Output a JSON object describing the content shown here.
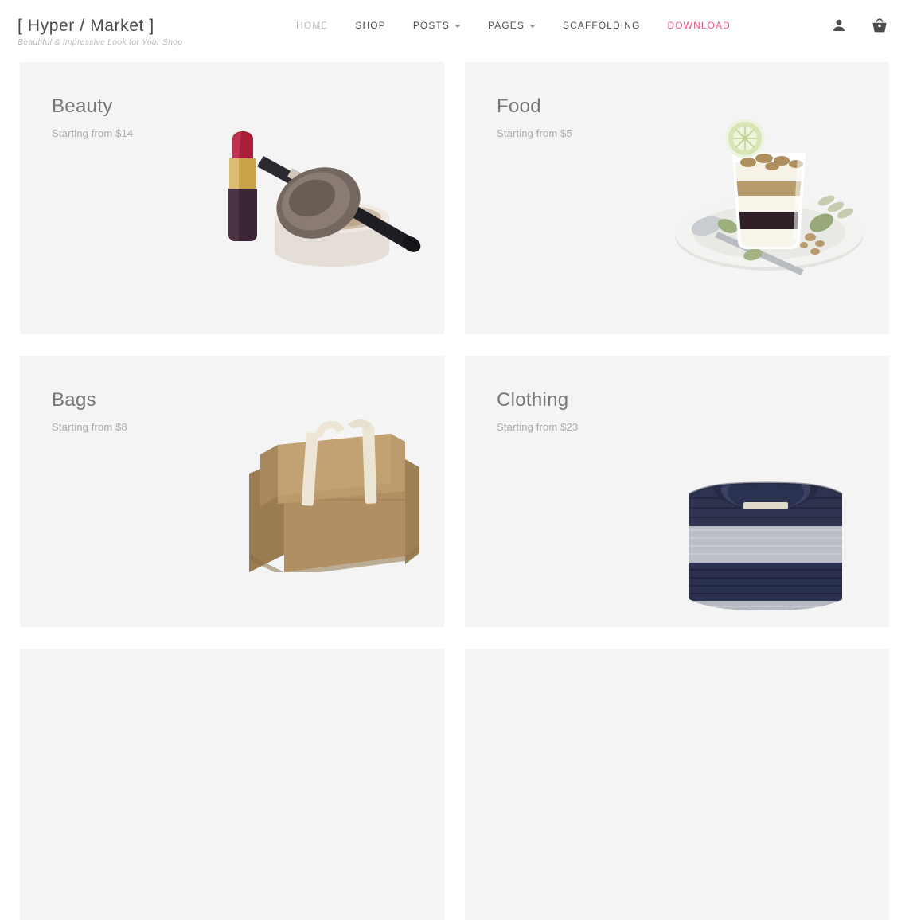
{
  "header": {
    "brand_title": "[ Hyper / Market ]",
    "brand_tagline": "Beautiful & Impressive Look for Your Shop",
    "nav": [
      {
        "label": "HOME",
        "state": "muted",
        "caret": false
      },
      {
        "label": "SHOP",
        "state": "normal",
        "caret": false
      },
      {
        "label": "POSTS",
        "state": "normal",
        "caret": true
      },
      {
        "label": "PAGES",
        "state": "normal",
        "caret": true
      },
      {
        "label": "SCAFFOLDING",
        "state": "normal",
        "caret": false
      },
      {
        "label": "DOWNLOAD",
        "state": "accent",
        "caret": false
      }
    ],
    "icons": [
      {
        "name": "account-icon",
        "glyph": "person"
      },
      {
        "name": "cart-icon",
        "glyph": "basket"
      }
    ]
  },
  "colors": {
    "accent": "#e8567c",
    "card_bg": "#f4f4f4",
    "page_bg": "#ffffff",
    "title_text": "#777777",
    "price_text": "#aaaaaa",
    "nav_text": "#4d4d4d",
    "nav_muted": "#bdbdbd"
  },
  "categories": [
    {
      "title": "Beauty",
      "price": "Starting from $14",
      "art": "beauty"
    },
    {
      "title": "Food",
      "price": "Starting from $5",
      "art": "food"
    },
    {
      "title": "Bags",
      "price": "Starting from $8",
      "art": "bag"
    },
    {
      "title": "Clothing",
      "price": "Starting from $23",
      "art": "clothing"
    }
  ],
  "placeholder_cards": 2
}
